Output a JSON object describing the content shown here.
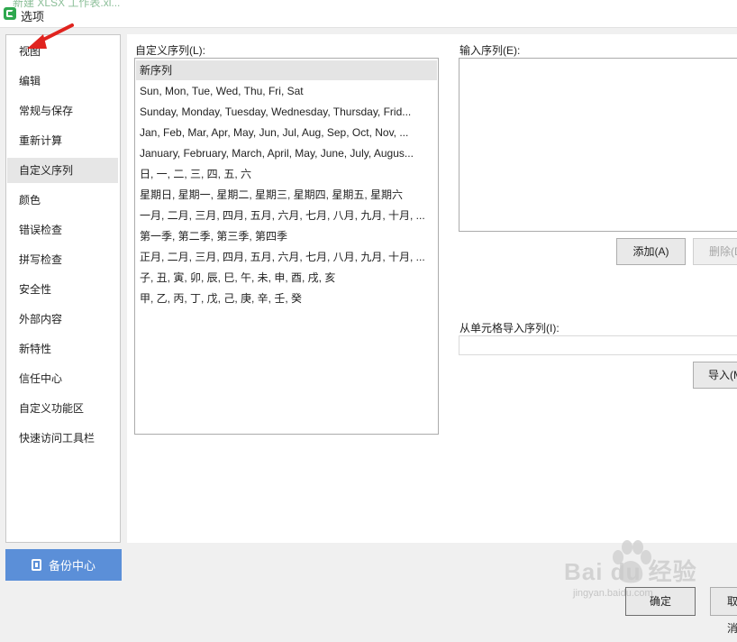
{
  "window": {
    "title": "选项",
    "background_tab_title": "新建 XLSX 工作表.xl..."
  },
  "sidebar": {
    "items": [
      {
        "label": "视图"
      },
      {
        "label": "编辑"
      },
      {
        "label": "常规与保存"
      },
      {
        "label": "重新计算"
      },
      {
        "label": "自定义序列",
        "selected": true
      },
      {
        "label": "颜色"
      },
      {
        "label": "错误检查"
      },
      {
        "label": "拼写检查"
      },
      {
        "label": "安全性"
      },
      {
        "label": "外部内容"
      },
      {
        "label": "新特性"
      },
      {
        "label": "信任中心"
      },
      {
        "label": "自定义功能区"
      },
      {
        "label": "快速访问工具栏"
      }
    ],
    "backup_label": "备份中心"
  },
  "custom_lists": {
    "label": "自定义序列(L):",
    "items": [
      "新序列",
      "Sun, Mon, Tue, Wed, Thu, Fri, Sat",
      "Sunday, Monday, Tuesday, Wednesday, Thursday, Frid...",
      "Jan, Feb, Mar, Apr, May, Jun, Jul, Aug, Sep, Oct, Nov, ...",
      "January, February, March, April, May, June, July, Augus...",
      "日, 一, 二, 三, 四, 五, 六",
      "星期日, 星期一, 星期二, 星期三, 星期四, 星期五, 星期六",
      "一月, 二月, 三月, 四月, 五月, 六月, 七月, 八月, 九月, 十月, ...",
      "第一季, 第二季, 第三季, 第四季",
      "正月, 二月, 三月, 四月, 五月, 六月, 七月, 八月, 九月, 十月, ...",
      "子, 丑, 寅, 卯, 辰, 巳, 午, 未, 申, 酉, 戌, 亥",
      "甲, 乙, 丙, 丁, 戊, 己, 庚, 辛, 壬, 癸"
    ]
  },
  "entries": {
    "label": "输入序列(E):",
    "value": "",
    "add_label": "添加(A)",
    "delete_label": "删除(D)"
  },
  "import": {
    "label": "从单元格导入序列(I):",
    "value": "",
    "button_label": "导入(M)"
  },
  "footer": {
    "ok_label": "确定",
    "cancel_label": "取消"
  },
  "watermark": {
    "text": "Bai du 经验",
    "sub": "jingyan.baidu.com"
  },
  "colors": {
    "accent": "#5b8fd8",
    "annotation": "#e0231e",
    "app_green": "#2ea84e"
  }
}
